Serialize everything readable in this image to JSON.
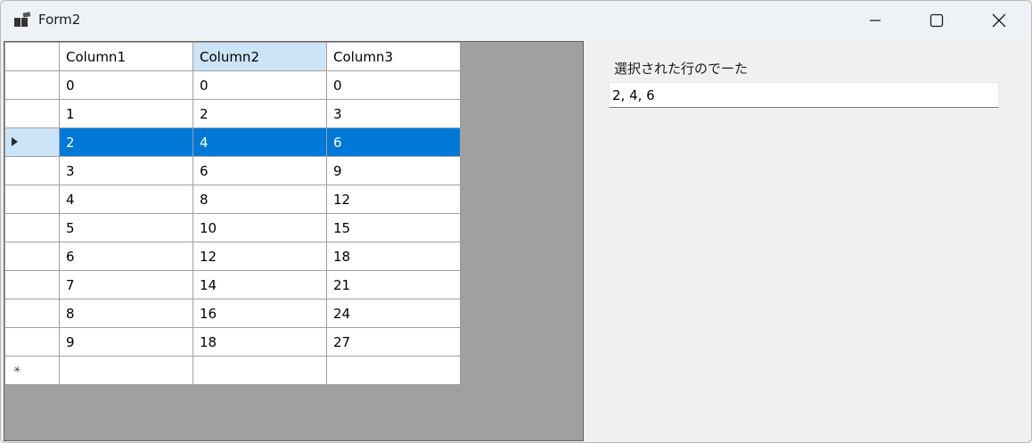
{
  "window": {
    "title": "Form2"
  },
  "grid": {
    "columns": [
      "Column1",
      "Column2",
      "Column3"
    ],
    "selected_row_index": 2,
    "highlighted_column_index": 1,
    "rows": [
      [
        "0",
        "0",
        "0"
      ],
      [
        "1",
        "2",
        "3"
      ],
      [
        "2",
        "4",
        "6"
      ],
      [
        "3",
        "6",
        "9"
      ],
      [
        "4",
        "8",
        "12"
      ],
      [
        "5",
        "10",
        "15"
      ],
      [
        "6",
        "12",
        "18"
      ],
      [
        "7",
        "14",
        "21"
      ],
      [
        "8",
        "16",
        "24"
      ],
      [
        "9",
        "18",
        "27"
      ]
    ],
    "new_row_icon": "new-row-star-icon",
    "current_row_icon": "row-pointer-icon"
  },
  "panel": {
    "label": "選択された行のでーた",
    "value": "2, 4, 6"
  },
  "colors": {
    "selection": "#0078d7",
    "header_highlight": "#cce4f7",
    "grid_background": "#a0a0a0"
  }
}
